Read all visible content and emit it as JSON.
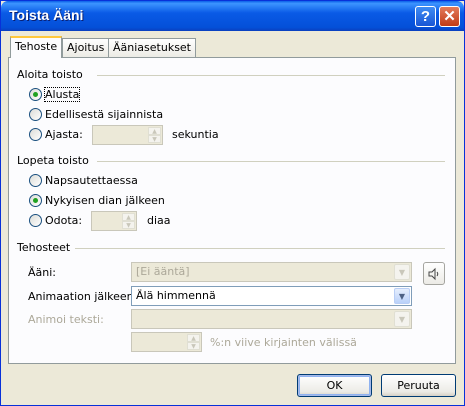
{
  "window": {
    "title": "Toista Ääni",
    "help": "?",
    "close": "✕"
  },
  "tabs": [
    {
      "label": "Tehoste",
      "active": true
    },
    {
      "label": "Ajoitus",
      "active": false
    },
    {
      "label": "Ääniasetukset",
      "active": false
    }
  ],
  "start": {
    "title": "Aloita toisto",
    "opt_beginning": "Alusta",
    "opt_previous": "Edellisestä sijainnista",
    "opt_time": "Ajasta:",
    "time_value": "",
    "time_unit": "sekuntia",
    "selected": "beginning"
  },
  "stop": {
    "title": "Lopeta toisto",
    "opt_click": "Napsautettaessa",
    "opt_after_slide": "Nykyisen dian jälkeen",
    "opt_wait": "Odota:",
    "wait_value": "",
    "wait_unit": "diaa",
    "selected": "after_slide"
  },
  "effects": {
    "title": "Tehosteet",
    "sound_label": "Ääni:",
    "sound_value": "[Ei ääntä]",
    "after_anim_label": "Animaation jälkeen:",
    "after_anim_value": "Älä himmennä",
    "animate_text_label": "Animoi teksti:",
    "animate_text_value": "",
    "delay_value": "",
    "delay_unit": "%:n viive kirjainten välissä",
    "sound_icon": "speaker-icon"
  },
  "buttons": {
    "ok": "OK",
    "cancel": "Peruuta"
  },
  "colors": {
    "titlebar": "#0a5ae6",
    "dialog_bg": "#ece9d8",
    "radio_dot": "#21a121",
    "active_tab_accent": "#ffc83c"
  }
}
